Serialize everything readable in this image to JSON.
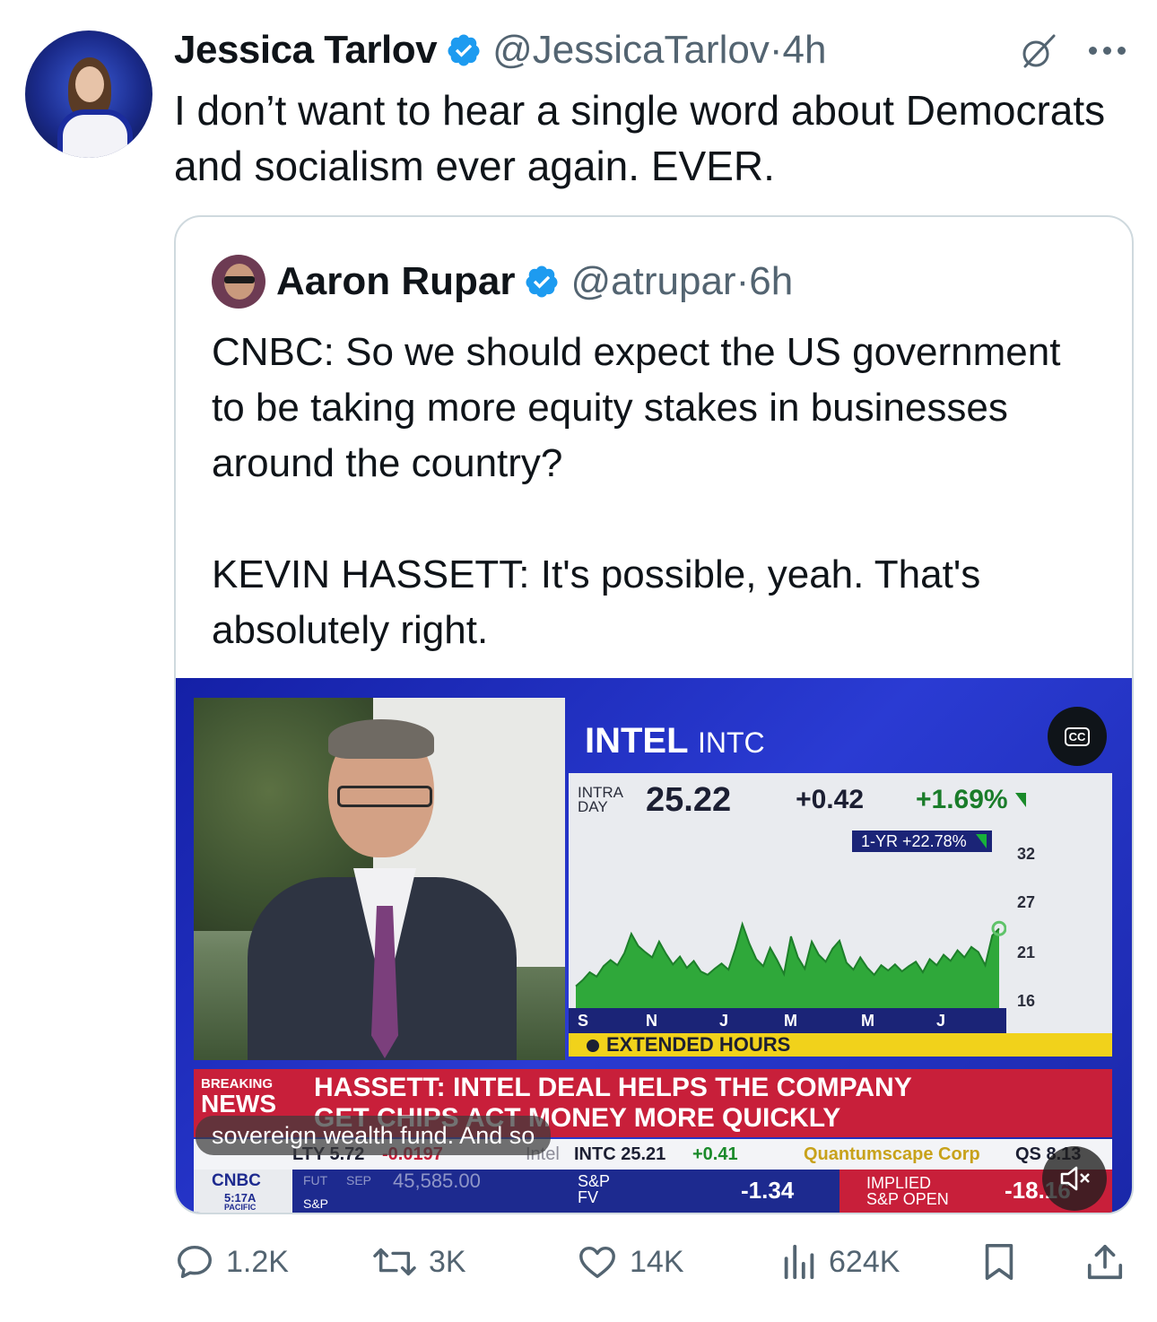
{
  "tweet": {
    "author_name": "Jessica Tarlov",
    "handle": "@JessicaTarlov",
    "separator": "·",
    "time": "4h",
    "text": "I don’t want to hear a single word about Democrats and socialism ever again. EVER."
  },
  "quoted": {
    "author_name": "Aaron Rupar",
    "handle": "@atrupar",
    "separator": "·",
    "time": "6h",
    "text": "CNBC: So we should expect the US government to be taking more equity stakes in businesses around the country?\n\nKEVIN HASSETT: It's possible, yeah. That's absolutely right."
  },
  "video": {
    "stock_name": "INTEL",
    "stock_ticker": "INTC",
    "intraday_label_1": "INTRA",
    "intraday_label_2": "DAY",
    "price": "25.22",
    "change": "+0.42",
    "change_pct": "+1.69%",
    "one_year_label": "1-YR",
    "one_year_change": "+22.78%",
    "y_ticks": [
      "32",
      "27",
      "21",
      "16"
    ],
    "x_ticks": [
      "S",
      "N",
      "J",
      "M",
      "M",
      "J"
    ],
    "extended_hours": "EXTENDED HOURS",
    "cc_label": "CC",
    "breaking_1": "BREAKING",
    "breaking_2": "NEWS",
    "headline_1": "HASSETT: INTEL DEAL HELPS THE COMPANY",
    "headline_2": "GET CHIPS ACT MONEY MORE QUICKLY",
    "caption": "sovereign wealth fund. And so",
    "ticker_a": "LTY 5.72",
    "ticker_a_chg": "-0.0197",
    "ticker_b_label": "Intel",
    "ticker_b": "INTC 25.21",
    "ticker_b_chg": "+0.41",
    "ticker_c": "Quantumscape Corp",
    "ticker_c_val": "QS 8.13",
    "ticker_mid_label": "FUT",
    "ticker_mid_month": "SEP",
    "ticker_mid_val": "45,585.00",
    "network": "CNBC",
    "clock": "5:17A",
    "clock_zone": "PACIFIC",
    "sp_label": "S&P",
    "spfv_1": "S&P",
    "spfv_2": "FV",
    "spfv_value": "-1.34",
    "implied_1": "IMPLIED",
    "implied_2": "S&P OPEN",
    "implied_value": "-18.16"
  },
  "chart_data": {
    "type": "area",
    "title": "INTEL INTC",
    "x_tick_labels": [
      "S",
      "N",
      "J",
      "M",
      "M",
      "J"
    ],
    "ylim": [
      16,
      32
    ],
    "y_ticks": [
      32,
      27,
      21,
      16
    ],
    "values": [
      18.5,
      19.2,
      20.1,
      19.6,
      20.8,
      21.5,
      20.9,
      22.3,
      24.5,
      23.1,
      22.4,
      21.8,
      23.6,
      22.2,
      21.0,
      21.9,
      20.6,
      21.4,
      20.2,
      19.8,
      20.5,
      21.1,
      20.4,
      22.8,
      25.6,
      23.4,
      21.6,
      20.8,
      22.9,
      21.5,
      19.9,
      24.2,
      21.8,
      20.5,
      23.6,
      22.1,
      21.3,
      22.8,
      23.7,
      21.2,
      20.4,
      21.8,
      20.6,
      19.8,
      20.9,
      20.3,
      21.0,
      20.2,
      20.8,
      21.3,
      20.1,
      21.6,
      20.9,
      22.1,
      21.4,
      22.6,
      21.8,
      23.0,
      22.4,
      20.9,
      24.3,
      25.1
    ],
    "color": "#2fa83a"
  },
  "actions": {
    "replies": "1.2K",
    "reposts": "3K",
    "likes": "14K",
    "views": "624K"
  },
  "colors": {
    "verified": "#1d9bf0",
    "secondary_text": "#536471",
    "cnbc_red": "#c81f3a",
    "cnbc_blue": "#1d2a8f"
  }
}
